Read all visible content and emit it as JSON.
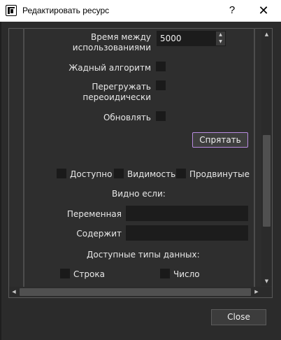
{
  "window": {
    "title": "Редактировать ресурс",
    "help_label": "?",
    "close_label": "✕"
  },
  "form": {
    "interval_label_line1": "Время между",
    "interval_label_line2": "использованиями",
    "interval_value": "5000",
    "greedy_label": "Жадный алгоритм",
    "reload_label_line1": "Перегружать",
    "reload_label_line2": "переоидически",
    "update_label": "Обновлять",
    "hide_button": "Спрятать",
    "available_label": "Доступно",
    "visibility_label": "Видимость",
    "advanced_label": "Продвинутые",
    "visible_if_label": "Видно если:",
    "variable_label": "Переменная",
    "variable_value": "",
    "contains_label": "Содержит",
    "contains_value": "",
    "data_types_label": "Доступные типы данных:",
    "string_label": "Строка",
    "number_label": "Число"
  },
  "footer": {
    "close_button": "Close"
  },
  "scroll": {
    "vertical_fraction": 0.55
  }
}
